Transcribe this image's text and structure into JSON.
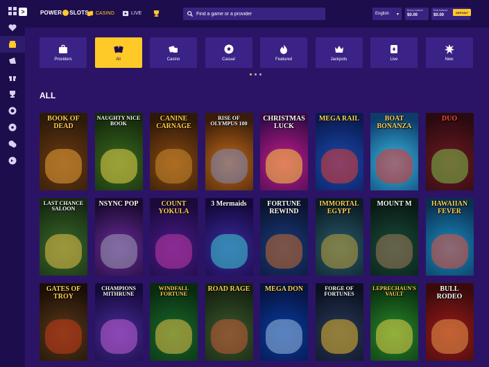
{
  "header": {
    "logo_left": "POWER",
    "logo_right": "SLOTS",
    "nav": [
      {
        "label": "CASINO",
        "icon": "spade-cards-icon"
      },
      {
        "label": "LIVE",
        "icon": "play-icon"
      },
      {
        "label": "",
        "icon": "trophy-icon"
      }
    ],
    "search_placeholder": "Find a game or a provider",
    "language": "English",
    "balance_label": "Bonus balance",
    "balance_value": "$0.00",
    "real_label": "Real balance",
    "real_value": "$0.00",
    "deposit_label": "DEPOSIT"
  },
  "sidebar": [
    {
      "icon": "heart-icon"
    },
    {
      "icon": "casino-chest-icon",
      "active": true
    },
    {
      "icon": "promotions-icon"
    },
    {
      "icon": "gift-icon"
    },
    {
      "icon": "trophy-icon"
    },
    {
      "icon": "wheel-icon"
    },
    {
      "icon": "chip-icon"
    },
    {
      "icon": "chat-icon"
    },
    {
      "icon": "logout-icon"
    }
  ],
  "categories": [
    {
      "label": "Providers",
      "icon": "briefcase-icon"
    },
    {
      "label": "All",
      "icon": "cards-icon",
      "active": true
    },
    {
      "label": "Casino",
      "icon": "dice-icon"
    },
    {
      "label": "Casual",
      "icon": "soccer-ball-icon"
    },
    {
      "label": "Featured",
      "icon": "fire-icon"
    },
    {
      "label": "Jackpots",
      "icon": "crown-icon"
    },
    {
      "label": "Live",
      "icon": "live-cards-icon"
    },
    {
      "label": "New",
      "icon": "new-burst-icon"
    }
  ],
  "section_title": "ALL",
  "games": [
    {
      "name": "BOOK OF DEAD",
      "c1": "#6b3a12",
      "c2": "#2d1a08",
      "accent": "#e8a03a",
      "tc": "#ffd25a"
    },
    {
      "name": "NAUGHTY NICE BOOK",
      "c1": "#3a6a1e",
      "c2": "#152a0c",
      "accent": "#e8d24a",
      "tc": "#ffffff"
    },
    {
      "name": "CANINE CARNAGE",
      "c1": "#8a4a12",
      "c2": "#2e1808",
      "accent": "#c98a2e",
      "tc": "#ffcf4a"
    },
    {
      "name": "RISE OF OLYMPUS 100",
      "c1": "#c06a18",
      "c2": "#3a1c0a",
      "accent": "#7a8ac0",
      "tc": "#ffffff"
    },
    {
      "name": "CHRISTMAS LUCK",
      "c1": "#c21d8a",
      "c2": "#3a0a4a",
      "accent": "#ffd23a",
      "tc": "#ffffff"
    },
    {
      "name": "MEGA RAIL",
      "c1": "#1a4ab0",
      "c2": "#0a1a50",
      "accent": "#e83a2a",
      "tc": "#ffd25a"
    },
    {
      "name": "BOAT BONANZA",
      "c1": "#38b6e0",
      "c2": "#0d3c6a",
      "accent": "#e8322a",
      "tc": "#ffd25a"
    },
    {
      "name": "DUO",
      "c1": "#6a1a20",
      "c2": "#2a0a10",
      "accent": "#7ac04a",
      "tc": "#ff4a3a"
    },
    {
      "name": "LAST CHANCE SALOON",
      "c1": "#3a6a2a",
      "c2": "#162a10",
      "accent": "#e8c04a",
      "tc": "#ffffff"
    },
    {
      "name": "NSYNC POP",
      "c1": "#6a2a9a",
      "c2": "#1a0a30",
      "accent": "#9aa0b0",
      "tc": "#ffffff"
    },
    {
      "name": "COUNT YOKULA",
      "c1": "#4a1a8a",
      "c2": "#1a0a3a",
      "accent": "#c03aa0",
      "tc": "#ffd25a"
    },
    {
      "name": "3 Mermaids",
      "c1": "#3a2aa0",
      "c2": "#14083a",
      "accent": "#3ad0d0",
      "tc": "#ffffff"
    },
    {
      "name": "FORTUNE REWIND",
      "c1": "#1a3a7a",
      "c2": "#0a1430",
      "accent": "#c86a2a",
      "tc": "#ffffff"
    },
    {
      "name": "IMMORTAL EGYPT",
      "c1": "#2a5a6a",
      "c2": "#0a1c24",
      "accent": "#c0a03a",
      "tc": "#ffd25a"
    },
    {
      "name": "MOUNT M",
      "c1": "#1a4a3a",
      "c2": "#081a14",
      "accent": "#a07a5a",
      "tc": "#ffffff"
    },
    {
      "name": "HAWAIIAN FEVER",
      "c1": "#1a8ac0",
      "c2": "#0a3050",
      "accent": "#e8503a",
      "tc": "#ffd25a"
    },
    {
      "name": "GATES OF TROY",
      "c1": "#5a3a1a",
      "c2": "#1a0e06",
      "accent": "#c83a1a",
      "tc": "#ffd25a"
    },
    {
      "name": "CHAMPIONS MITHRUNE",
      "c1": "#4a2a9a",
      "c2": "#140a3a",
      "accent": "#c060d0",
      "tc": "#ffffff"
    },
    {
      "name": "WINDFALL FORTUNE",
      "c1": "#1a6a2a",
      "c2": "#082a10",
      "accent": "#e8c04a",
      "tc": "#ffd25a"
    },
    {
      "name": "ROAD RAGE",
      "c1": "#3a5a2a",
      "c2": "#142010",
      "accent": "#c85a3a",
      "tc": "#ffd25a"
    },
    {
      "name": "MEGA DON",
      "c1": "#0a3aa0",
      "c2": "#061440",
      "accent": "#9ac0e0",
      "tc": "#ffd25a"
    },
    {
      "name": "FORGE OF FORTUNES",
      "c1": "#2a3a5a",
      "c2": "#0a1020",
      "accent": "#e8b82a",
      "tc": "#ffffff"
    },
    {
      "name": "LEPRECHAUN'S VAULT",
      "c1": "#2a8a2a",
      "c2": "#0a3010",
      "accent": "#e8d04a",
      "tc": "#ffd25a"
    },
    {
      "name": "BULL RODEO",
      "c1": "#9a1a1a",
      "c2": "#3a0a0a",
      "accent": "#e89a4a",
      "tc": "#ffffff"
    }
  ]
}
